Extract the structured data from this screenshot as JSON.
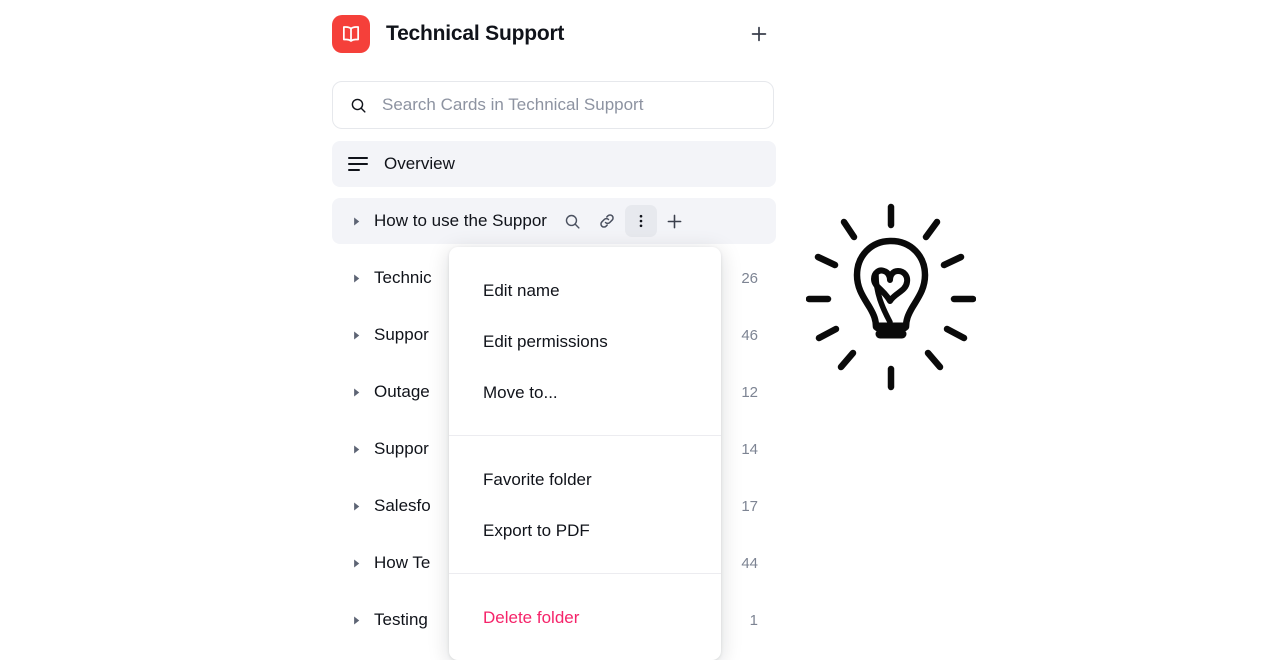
{
  "header": {
    "logo_icon": "book-icon",
    "logo_color": "#f5403a",
    "title": "Technical Support",
    "add_icon": "plus-icon",
    "add_label": "+"
  },
  "search": {
    "icon": "search-icon",
    "placeholder": "Search Cards in Technical Support",
    "value": ""
  },
  "nav": {
    "rows": [
      {
        "id": "overview",
        "icon": "text-lines-icon",
        "label": "Overview",
        "count": "",
        "highlight": true,
        "has_caret": false,
        "has_actions": false
      },
      {
        "id": "how-to-use-the-support",
        "icon": "caret-right-icon",
        "label": "How to use the Suppor",
        "count": "",
        "highlight": true,
        "has_caret": true,
        "has_actions": true,
        "actions": [
          {
            "name": "search-icon",
            "label": "Search",
            "active": false
          },
          {
            "name": "link-icon",
            "label": "Copy link",
            "active": false
          },
          {
            "name": "more-vertical-icon",
            "label": "More options",
            "active": true
          },
          {
            "name": "plus-icon",
            "label": "Add",
            "active": false
          }
        ]
      },
      {
        "id": "technical",
        "icon": "caret-right-icon",
        "label": "Technic",
        "count": "26",
        "highlight": false,
        "has_caret": true,
        "has_actions": false
      },
      {
        "id": "support-1",
        "icon": "caret-right-icon",
        "label": "Suppor",
        "count": "46",
        "highlight": false,
        "has_caret": true,
        "has_actions": false
      },
      {
        "id": "outages",
        "icon": "caret-right-icon",
        "label": "Outage",
        "count": "12",
        "highlight": false,
        "has_caret": true,
        "has_actions": false
      },
      {
        "id": "support-2",
        "icon": "caret-right-icon",
        "label": "Suppor",
        "count": "14",
        "highlight": false,
        "has_caret": true,
        "has_actions": false
      },
      {
        "id": "salesforce",
        "icon": "caret-right-icon",
        "label": "Salesfo",
        "count": "17",
        "highlight": false,
        "has_caret": true,
        "has_actions": false
      },
      {
        "id": "how-te",
        "icon": "caret-right-icon",
        "label": "How Te",
        "count": "44",
        "highlight": false,
        "has_caret": true,
        "has_actions": false
      },
      {
        "id": "testing",
        "icon": "caret-right-icon",
        "label": "Testing",
        "count": "1",
        "highlight": false,
        "has_caret": true,
        "has_actions": false
      }
    ]
  },
  "context_menu": {
    "groups": [
      {
        "items": [
          {
            "id": "edit-name",
            "label": "Edit name",
            "danger": false
          },
          {
            "id": "edit-permissions",
            "label": "Edit permissions",
            "danger": false
          },
          {
            "id": "move-to",
            "label": "Move to...",
            "danger": false
          }
        ]
      },
      {
        "items": [
          {
            "id": "favorite-folder",
            "label": "Favorite folder",
            "danger": false
          },
          {
            "id": "export-to-pdf",
            "label": "Export to PDF",
            "danger": false
          }
        ]
      },
      {
        "items": [
          {
            "id": "delete-folder",
            "label": "Delete folder",
            "danger": true
          }
        ]
      }
    ],
    "danger_color": "#f5246a"
  },
  "illustration": {
    "name": "lightbulb-heart-doodle",
    "description": "hand drawn lightbulb with heart inside and radiating rays"
  }
}
